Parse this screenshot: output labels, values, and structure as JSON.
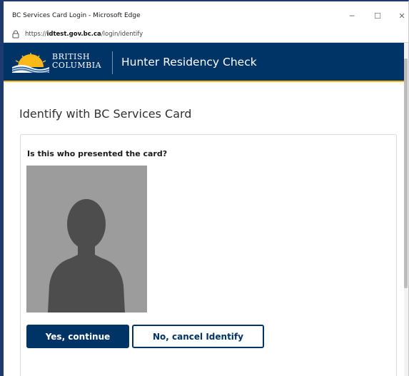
{
  "window": {
    "title": "BC Services Card Login - Microsoft Edge",
    "controls": {
      "minimize": "─",
      "maximize": "☐",
      "close": "✕"
    }
  },
  "address": {
    "protocol": "https://",
    "domain": "idtest.gov.bc.ca",
    "path": "/login/identify",
    "icon": "lock-icon"
  },
  "header": {
    "logo_line1": "BRITISH",
    "logo_line2": "COLUMBIA",
    "app_title": "Hunter Residency Check",
    "accent_color": "#fcba19",
    "brand_color": "#003366"
  },
  "main": {
    "heading": "Identify with BC Services Card",
    "question": "Is this who presented the card?",
    "photo_icon": "person-silhouette-icon",
    "buttons": {
      "confirm": "Yes, continue",
      "cancel": "No, cancel Identify"
    }
  }
}
